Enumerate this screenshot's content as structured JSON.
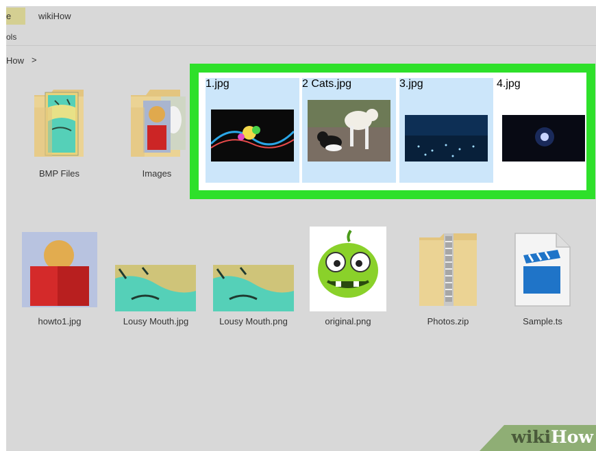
{
  "window": {
    "tab_fragment": "e",
    "title": "wikiHow",
    "ribbon_fragment": "ols"
  },
  "address": {
    "crumb": "How",
    "separator": ">"
  },
  "files_row1": [
    {
      "label": "BMP Files",
      "icon": "folder-with-images-icon"
    },
    {
      "label": "Images",
      "icon": "folder-with-images-icon"
    }
  ],
  "selection": [
    {
      "label": "1.jpg",
      "selected": true,
      "icon": "image-thumbnail"
    },
    {
      "label": "2 Cats.jpg",
      "selected": true,
      "icon": "image-thumbnail"
    },
    {
      "label": "3.jpg",
      "selected": true,
      "icon": "image-thumbnail"
    },
    {
      "label": "4.jpg",
      "selected": false,
      "icon": "image-thumbnail"
    }
  ],
  "files_row2": [
    {
      "label": "howto1.jpg",
      "icon": "image-thumbnail"
    },
    {
      "label": "Lousy Mouth.jpg",
      "icon": "image-thumbnail"
    },
    {
      "label": "Lousy Mouth.png",
      "icon": "image-thumbnail"
    },
    {
      "label": "original.png",
      "icon": "image-thumbnail"
    },
    {
      "label": "Photos.zip",
      "icon": "zip-folder-icon"
    },
    {
      "label": "Sample.ts",
      "icon": "video-file-icon"
    }
  ],
  "highlight_color": "#2ee02a",
  "selected_color": "#cce6fa",
  "watermark": {
    "part1": "wiki",
    "part2": "How"
  }
}
